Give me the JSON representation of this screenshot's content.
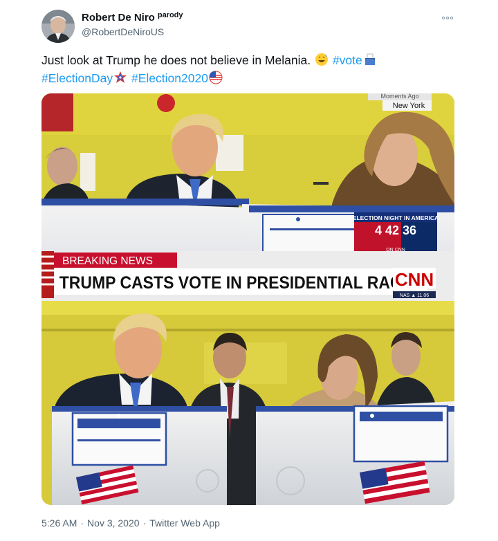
{
  "author": {
    "display_name": "Robert De Niro",
    "badge": "parody",
    "handle": "@RobertDeNiroUS"
  },
  "more_icon": "more-dots-icon",
  "tweet": {
    "line1_text": "Just look at Trump he does not believe in Melania.",
    "line1_hashtag": "#vote",
    "line2_hashtag1": "#ElectionDay",
    "line2_hashtag2": "#Election2020",
    "emojis": [
      "grinning-sweat-emoji",
      "ballot-box-emoji",
      "flag-star-emoji",
      "flag-ball-emoji"
    ]
  },
  "media": {
    "top_corner": {
      "line1": "Moments Ago",
      "line2": "New York"
    },
    "election_bug": {
      "title": "ELECTION NIGHT IN AMERICA",
      "time": "4 42 36",
      "small": "ON CNN"
    },
    "breaking_label": "BREAKING NEWS",
    "headline": "TRUMP CASTS VOTE IN PRESIDENTIAL RACE",
    "network": "CNN",
    "ticker": "NAS ▲ 11.06"
  },
  "meta": {
    "time": "5:26 AM",
    "separator": "·",
    "date": "Nov 3, 2020",
    "source": "Twitter Web App"
  },
  "colors": {
    "link": "#1d9bf0",
    "muted": "#536471",
    "cnn_red": "#cc0000"
  }
}
